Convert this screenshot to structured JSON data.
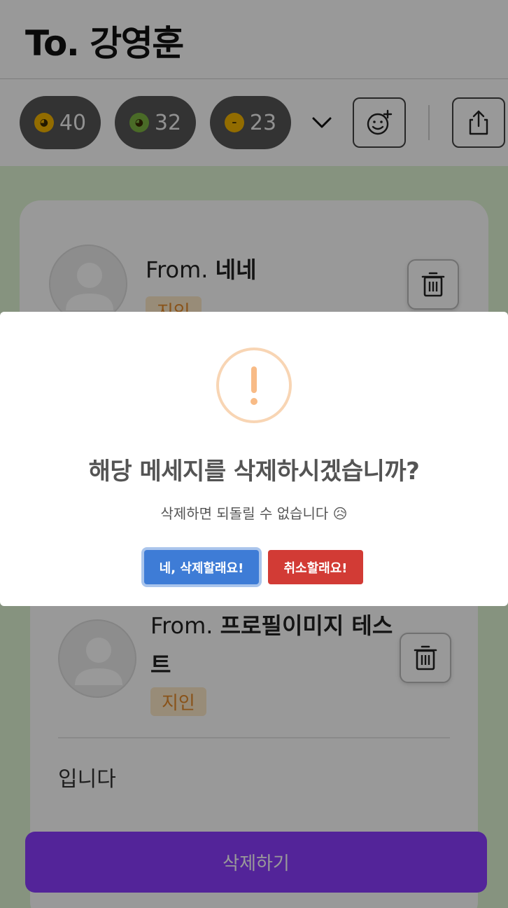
{
  "header": {
    "title": "To. 강영훈"
  },
  "reactions": [
    {
      "emoji_icon": "saluting-face-icon",
      "emoji_color": "#f4b400",
      "count": "40"
    },
    {
      "emoji_icon": "nauseated-face-icon",
      "emoji_color": "#7cb342",
      "count": "32"
    },
    {
      "emoji_icon": "expressionless-face-icon",
      "emoji_color": "#f4b400",
      "count": "23"
    }
  ],
  "toolbar": {
    "expand_icon": "chevron-down-icon",
    "add_reaction_icon": "smiley-plus-icon",
    "share_icon": "share-icon"
  },
  "cards": [
    {
      "from_prefix": "From. ",
      "from_name": "네네",
      "tag": "지인"
    },
    {
      "from_prefix": "From. ",
      "from_name": "프로필이미지 테스",
      "from_name_wrap": "트",
      "tag": "지인",
      "message": "입니다"
    }
  ],
  "delete_bar": {
    "label": "삭제하기",
    "color": "#8a3cff"
  },
  "dialog": {
    "icon": "exclamation-circle-icon",
    "icon_color": "#f8bb86",
    "title": "해당 메세지를 삭제하시겠습니까?",
    "text": "삭제하면 되돌릴 수 없습니다 😥",
    "confirm_label": "네, 삭제할래요!",
    "cancel_label": "취소할래요!",
    "confirm_color": "#3e7cd6",
    "cancel_color": "#d23b35"
  }
}
